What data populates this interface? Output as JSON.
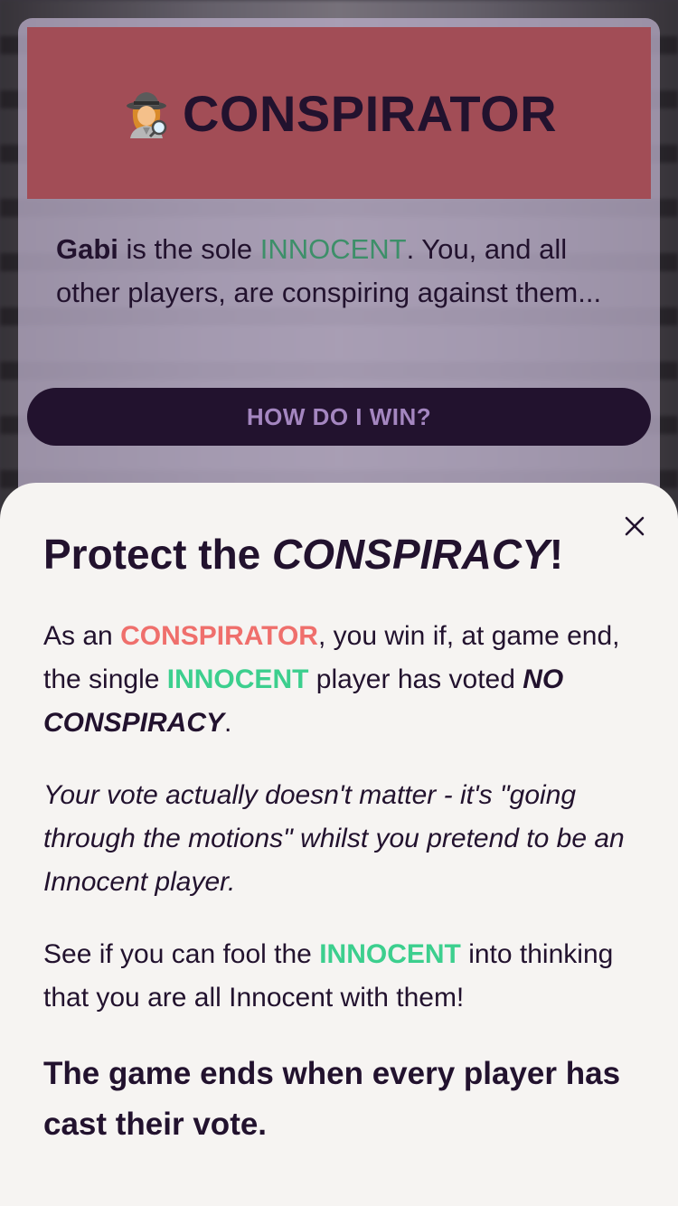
{
  "role_card": {
    "emoji_icon": "detective-icon",
    "title": "CONSPIRATOR",
    "description": {
      "player_name": "Gabi",
      "text_1": " is the sole ",
      "innocent": "INNOCENT",
      "text_2": ". You, and all other players, are conspiring against them..."
    },
    "how_button": "HOW DO I WIN?"
  },
  "sheet": {
    "title_prefix": "Protect the ",
    "title_emphasis": "CONSPIRACY",
    "title_suffix": "!",
    "p1": {
      "a": "As an ",
      "conspirator": "CONSPIRATOR",
      "b": ", you win if, at game end, the single ",
      "innocent": "INNOCENT",
      "c": " player has voted ",
      "no_conspiracy": "NO CONSPIRACY",
      "d": "."
    },
    "p2": "Your vote actually doesn't matter - it's \"going through the motions\" whilst you pretend to be an Innocent player.",
    "p3": {
      "a": "See if you can fool the ",
      "innocent": "INNOCENT",
      "b": " into thinking that you are all Innocent with them!"
    },
    "p4": "The game ends when every player has cast their vote.",
    "close_icon": "close-icon"
  },
  "colors": {
    "header_bg": "#a24d56",
    "dark": "#22122e",
    "conspirator": "#ef6f6c",
    "innocent": "#3ccf8e",
    "innocent_dim": "#3d8f69",
    "button_text": "#a486c0"
  }
}
